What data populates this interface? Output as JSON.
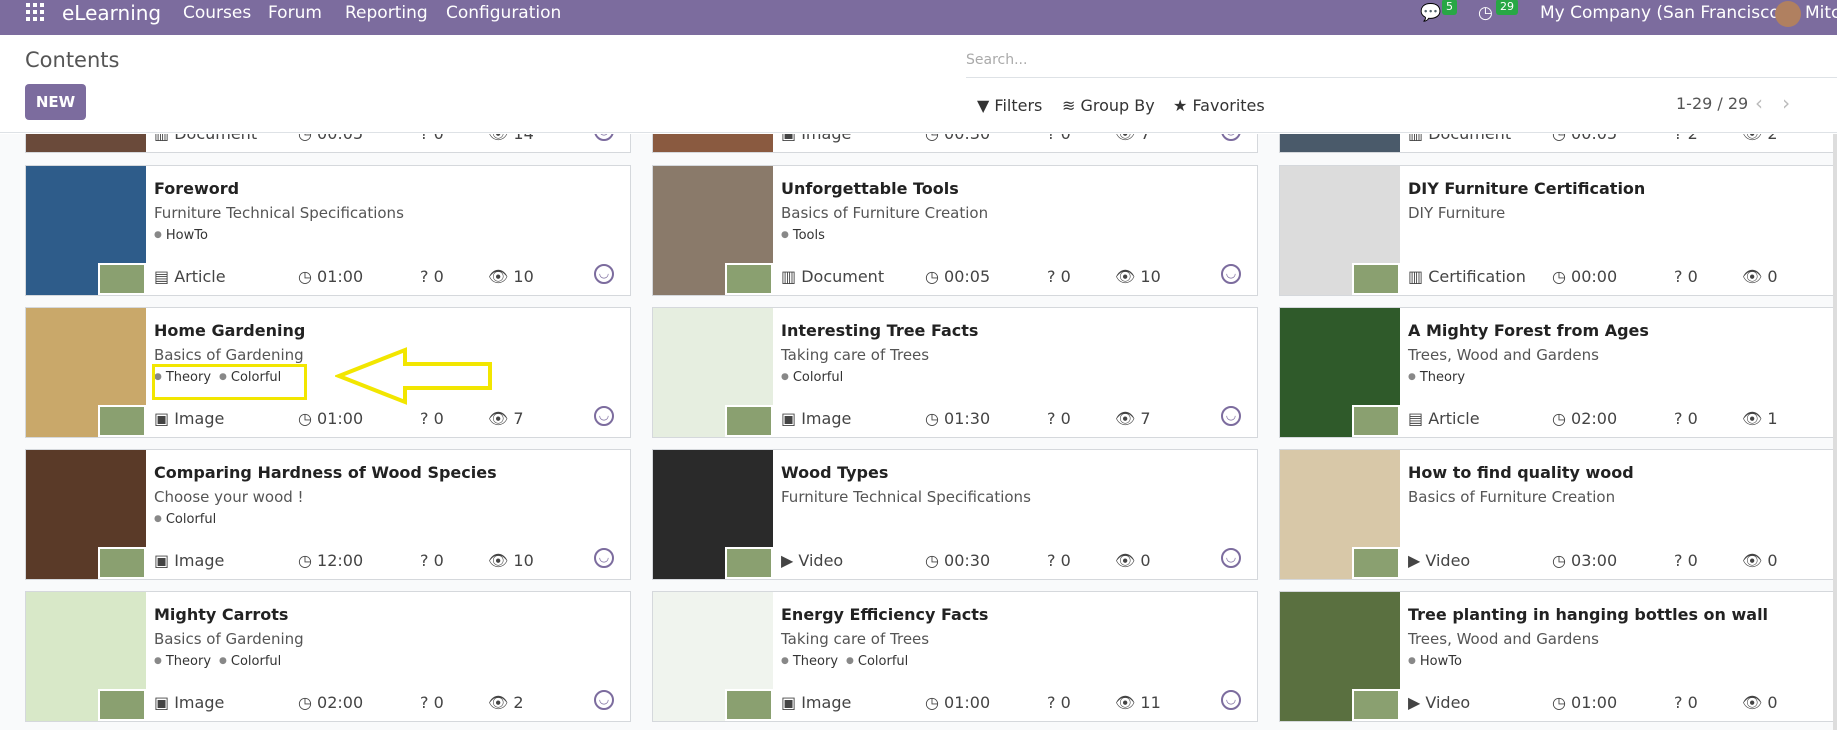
{
  "app": {
    "brand": "eLearning",
    "menu": [
      "Courses",
      "Forum",
      "Reporting",
      "Configuration"
    ],
    "messages_count": "5",
    "activities_count": "29",
    "company": "My Company (San Francisco)",
    "user": "Mitc"
  },
  "control": {
    "title": "Contents",
    "new_label": "NEW",
    "search_placeholder": "Search...",
    "filters_label": "Filters",
    "groupby_label": "Group By",
    "favorites_label": "Favorites",
    "pager": "1-29 / 29"
  },
  "partial_row": [
    {
      "type": "Document",
      "duration": "00:05",
      "questions": "0",
      "views": "14"
    },
    {
      "type": "Image",
      "duration": "00:30",
      "questions": "0",
      "views": "7"
    },
    {
      "type": "Document",
      "duration": "00:05",
      "questions": "2",
      "views": "2"
    }
  ],
  "cards": [
    {
      "title": "Foreword",
      "course": "Furniture Technical Specifications",
      "tags": [
        "HowTo"
      ],
      "type": "Article",
      "duration": "01:00",
      "questions": "0",
      "views": "10"
    },
    {
      "title": "Unforgettable Tools",
      "course": "Basics of Furniture Creation",
      "tags": [
        "Tools"
      ],
      "type": "Document",
      "duration": "00:05",
      "questions": "0",
      "views": "10"
    },
    {
      "title": "DIY Furniture Certification",
      "course": "DIY Furniture",
      "tags": [],
      "type": "Certification",
      "duration": "00:00",
      "questions": "0",
      "views": "0"
    },
    {
      "title": "Home Gardening",
      "course": "Basics of Gardening",
      "tags": [
        "Theory",
        "Colorful"
      ],
      "type": "Image",
      "duration": "01:00",
      "questions": "0",
      "views": "7"
    },
    {
      "title": "Interesting Tree Facts",
      "course": "Taking care of Trees",
      "tags": [
        "Colorful"
      ],
      "type": "Image",
      "duration": "01:30",
      "questions": "0",
      "views": "7"
    },
    {
      "title": "A Mighty Forest from Ages",
      "course": "Trees, Wood and Gardens",
      "tags": [
        "Theory"
      ],
      "type": "Article",
      "duration": "02:00",
      "questions": "0",
      "views": "1"
    },
    {
      "title": "Comparing Hardness of Wood Species",
      "course": "Choose your wood !",
      "tags": [
        "Colorful"
      ],
      "type": "Image",
      "duration": "12:00",
      "questions": "0",
      "views": "10"
    },
    {
      "title": "Wood Types",
      "course": "Furniture Technical Specifications",
      "tags": [],
      "type": "Video",
      "duration": "00:30",
      "questions": "0",
      "views": "0"
    },
    {
      "title": "How to find quality wood",
      "course": "Basics of Furniture Creation",
      "tags": [],
      "type": "Video",
      "duration": "03:00",
      "questions": "0",
      "views": "0"
    },
    {
      "title": "Mighty Carrots",
      "course": "Basics of Gardening",
      "tags": [
        "Theory",
        "Colorful"
      ],
      "type": "Image",
      "duration": "02:00",
      "questions": "0",
      "views": "2"
    },
    {
      "title": "Energy Efficiency Facts",
      "course": "Taking care of Trees",
      "tags": [
        "Theory",
        "Colorful"
      ],
      "type": "Image",
      "duration": "01:00",
      "questions": "0",
      "views": "11"
    },
    {
      "title": "Tree planting in hanging bottles on wall",
      "course": "Trees, Wood and Gardens",
      "tags": [
        "HowTo"
      ],
      "type": "Video",
      "duration": "01:00",
      "questions": "0",
      "views": "0"
    }
  ],
  "thumb_colors": [
    "#2e5c8a",
    "#8a7a6a",
    "#dcdcdc",
    "#c9a86a",
    "#e6eee0",
    "#2f5a2a",
    "#5a3a28",
    "#2a2a2a",
    "#d8c8a8",
    "#d8e8c8",
    "#f0f4ee",
    "#5a7040"
  ],
  "colors": {
    "brand": "#7c6c9e",
    "highlight": "#f2e600"
  }
}
